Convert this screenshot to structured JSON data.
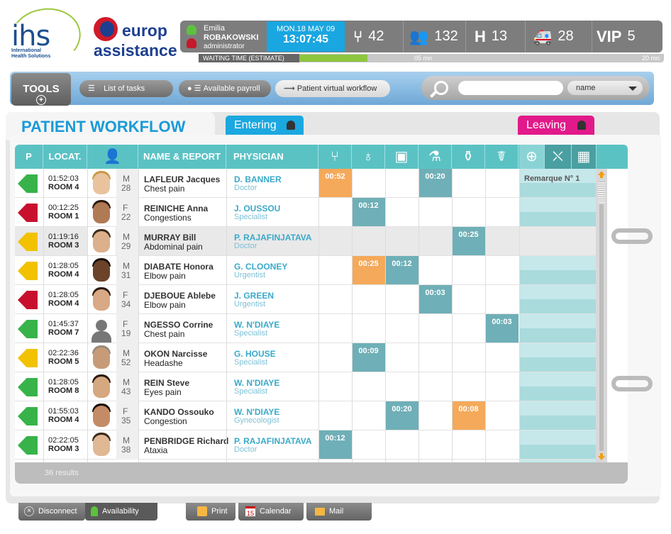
{
  "logo_ihs": {
    "name": "ihs",
    "sub1": "International",
    "sub2": "Health Solutions"
  },
  "logo_ea": {
    "line1": "europ",
    "line2": "assistance"
  },
  "user": {
    "first_name": "Emilia",
    "last_name": "ROBAKOWSKI",
    "role": "administrator"
  },
  "datetime": {
    "date": "MON.18 MAY 09",
    "time": "13:07:45"
  },
  "stats": [
    {
      "icon": "waiting-icon",
      "value": "42"
    },
    {
      "icon": "patients-icon",
      "value": "132"
    },
    {
      "icon": "hospital-icon",
      "label": "H",
      "value": "13"
    },
    {
      "icon": "ambulance-icon",
      "value": "28"
    },
    {
      "icon": "vip-icon",
      "label": "VIP",
      "value": "5"
    }
  ],
  "waiting": {
    "label": "WAITING TIME (ESTIMATE)",
    "current": "05 mn",
    "max": "20 mn",
    "fill_fraction": 0.25
  },
  "tools": {
    "tools_label": "TOOLS",
    "list_tasks": "List of tasks",
    "payroll": "Available payroll",
    "workflow": "Patient virtual workflow",
    "search_value": "",
    "search_select": "name"
  },
  "workflow": {
    "title": "PATIENT WORKFLOW",
    "entering": "Entering",
    "leaving": "Leaving"
  },
  "columns": {
    "p": "P",
    "locat": "LOCAT.",
    "name": "NAME & REPORT",
    "physician": "PHYSICIAN"
  },
  "stage_icons": [
    "consultation-icon",
    "stethoscope-icon",
    "scanner-icon",
    "microscope-icon",
    "lab-icon",
    "pharmacy-icon",
    "first-aid-icon",
    "stretcher-icon",
    "calculator-icon"
  ],
  "colors": {
    "green": "#37b34a",
    "red": "#c8102e",
    "yellow": "#f2c200",
    "teal": "#5bc2c4",
    "orange": "#f5a95a",
    "blue": "#1ba8e0",
    "pink": "#e2198a"
  },
  "patients": [
    {
      "prio": "green",
      "time": "01:52:03",
      "room": "ROOM 4",
      "sex": "M",
      "age": "28",
      "name": "LAFLEUR Jacques",
      "report": "Chest pain",
      "physician": "D. BANNER",
      "role": "Doctor",
      "photo": true,
      "skin": "#e8c39e",
      "hair": "#c79a4a",
      "cells": [
        {
          "col": 0,
          "t": "00:52",
          "c": "o"
        },
        {
          "col": 3,
          "t": "00:20",
          "c": "t"
        }
      ],
      "remark": "Remarque N° 1"
    },
    {
      "prio": "red",
      "time": "00:12:25",
      "room": "ROOM 1",
      "sex": "F",
      "age": "22",
      "name": "REINICHE Anna",
      "report": "Congestions",
      "physician": "J. OUSSOU",
      "role": "Specialist",
      "photo": true,
      "skin": "#b07a55",
      "hair": "#2a1a10",
      "cells": [
        {
          "col": 1,
          "t": "00:12",
          "c": "t"
        }
      ]
    },
    {
      "prio": "yellow",
      "time": "01:19:16",
      "room": "ROOM 3",
      "sex": "M",
      "age": "29",
      "name": "MURRAY Bill",
      "report": "Abdominal pain",
      "physician": "P. RAJAFINJATAVA",
      "role": "Doctor",
      "photo": true,
      "skin": "#dcb08a",
      "hair": "#3a2a1a",
      "cells": [
        {
          "col": 4,
          "t": "00:25",
          "c": "t"
        }
      ]
    },
    {
      "prio": "yellow",
      "time": "01:28:05",
      "room": "ROOM 4",
      "sex": "M",
      "age": "31",
      "name": "DIABATE Honora",
      "report": "Elbow pain",
      "physician": "G. CLOONEY",
      "role": "Urgentist",
      "photo": true,
      "skin": "#6b4329",
      "hair": "#1a1008",
      "cells": [
        {
          "col": 1,
          "t": "00:25",
          "c": "o"
        },
        {
          "col": 2,
          "t": "00:12",
          "c": "t"
        }
      ]
    },
    {
      "prio": "red",
      "time": "01:28:05",
      "room": "ROOM 4",
      "sex": "F",
      "age": "34",
      "name": "DJEBOUE Ablebe",
      "report": "Elbow pain",
      "physician": "J. GREEN",
      "role": "Urgentist",
      "photo": true,
      "skin": "#d9a884",
      "hair": "#2a1a10",
      "cells": [
        {
          "col": 3,
          "t": "00:03",
          "c": "t"
        }
      ]
    },
    {
      "prio": "green",
      "time": "01:45:37",
      "room": "ROOM 7",
      "sex": "F",
      "age": "19",
      "name": "NGESSO Corrine",
      "report": "Chest pain",
      "physician": "W. N'DIAYE",
      "role": "Specialist",
      "photo": false,
      "skin": "#777",
      "hair": "#777",
      "cells": [
        {
          "col": 5,
          "t": "00:03",
          "c": "t"
        }
      ]
    },
    {
      "prio": "yellow",
      "time": "02:22:36",
      "room": "ROOM 5",
      "sex": "M",
      "age": "52",
      "name": "OKON Narcisse",
      "report": "Headashe",
      "physician": "G. HOUSE",
      "role": "Specialist",
      "photo": true,
      "skin": "#c89b78",
      "hair": "#9a8a7a",
      "cells": [
        {
          "col": 1,
          "t": "00:09",
          "c": "t"
        }
      ]
    },
    {
      "prio": "green",
      "time": "01:28:05",
      "room": "ROOM 8",
      "sex": "M",
      "age": "43",
      "name": "REIN Steve",
      "report": "Eyes pain",
      "physician": "W. N'DIAYE",
      "role": "Specialist",
      "photo": true,
      "skin": "#d6a880",
      "hair": "#2a1a10",
      "cells": []
    },
    {
      "prio": "green",
      "time": "01:55:03",
      "room": "ROOM 4",
      "sex": "F",
      "age": "35",
      "name": "KANDO Ossouko",
      "report": "Congestion",
      "physician": "W. N'DIAYE",
      "role": "Gynecologist",
      "photo": true,
      "skin": "#c48c66",
      "hair": "#1a1008",
      "cells": [
        {
          "col": 2,
          "t": "00:20",
          "c": "t"
        },
        {
          "col": 4,
          "t": "00:08",
          "c": "o"
        }
      ]
    },
    {
      "prio": "green",
      "time": "02:22:05",
      "room": "ROOM 3",
      "sex": "M",
      "age": "38",
      "name": "PENBRIDGE Richard",
      "report": "Ataxia",
      "physician": "P. RAJAFINJATAVA",
      "role": "Doctor",
      "photo": true,
      "skin": "#e0b894",
      "hair": "#3a2a1a",
      "cells": [
        {
          "col": 0,
          "t": "00:12",
          "c": "t"
        }
      ]
    }
  ],
  "results": "36 results",
  "bottom": {
    "disconnect": "Disconnect",
    "availability": "Availability",
    "print": "Print",
    "calendar": "Calendar",
    "calendar_day": "15",
    "mail": "Mail"
  }
}
